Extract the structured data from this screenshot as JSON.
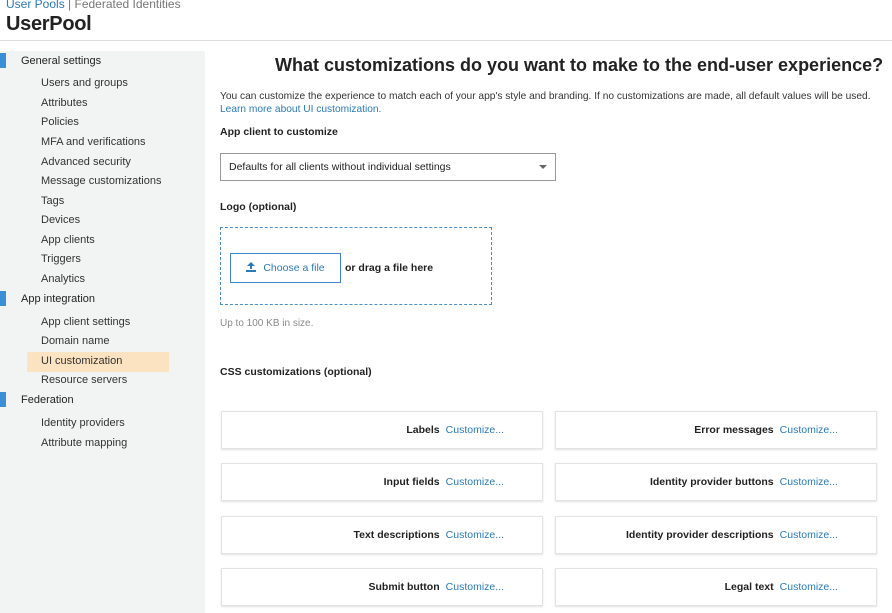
{
  "breadcrumb": {
    "link": "User Pools",
    "separator": "|",
    "current": "Federated Identities"
  },
  "page_title": "UserPool",
  "sidebar": {
    "sections": [
      {
        "label": "General settings",
        "items": [
          "Users and groups",
          "Attributes",
          "Policies",
          "MFA and verifications",
          "Advanced security",
          "Message customizations",
          "Tags",
          "Devices",
          "App clients",
          "Triggers",
          "Analytics"
        ]
      },
      {
        "label": "App integration",
        "items": [
          "App client settings",
          "Domain name",
          "UI customization",
          "Resource servers"
        ]
      },
      {
        "label": "Federation",
        "items": [
          "Identity providers",
          "Attribute mapping"
        ]
      }
    ],
    "active_item": "UI customization"
  },
  "main": {
    "heading": "What customizations do you want to make to the end-user experience?",
    "intro_text": "You can customize the experience to match each of your app's style and branding. If no customizations are made, all default values will be used.",
    "intro_link": "Learn more about UI customization.",
    "app_client_label": "App client to customize",
    "app_client_value": "Defaults for all clients without individual settings",
    "logo_label": "Logo (optional)",
    "choose_file_label": "Choose a file",
    "drag_text": "or drag a file here",
    "size_hint": "Up to 100 KB in size.",
    "css_label": "CSS customizations (optional)",
    "customize_link": "Customize...",
    "cards": [
      {
        "label": "Labels"
      },
      {
        "label": "Error messages"
      },
      {
        "label": "Input fields"
      },
      {
        "label": "Identity provider buttons"
      },
      {
        "label": "Text descriptions"
      },
      {
        "label": "Identity provider descriptions"
      },
      {
        "label": "Submit button"
      },
      {
        "label": "Legal text"
      }
    ]
  },
  "colors": {
    "accent": "#3a8fd6",
    "link": "#2a7ab8",
    "active_bg": "#fbe3c1",
    "sidebar_bg": "#f2f3f3"
  },
  "icons": {
    "upload": "upload-icon",
    "dropdown": "chevron-down-icon"
  }
}
